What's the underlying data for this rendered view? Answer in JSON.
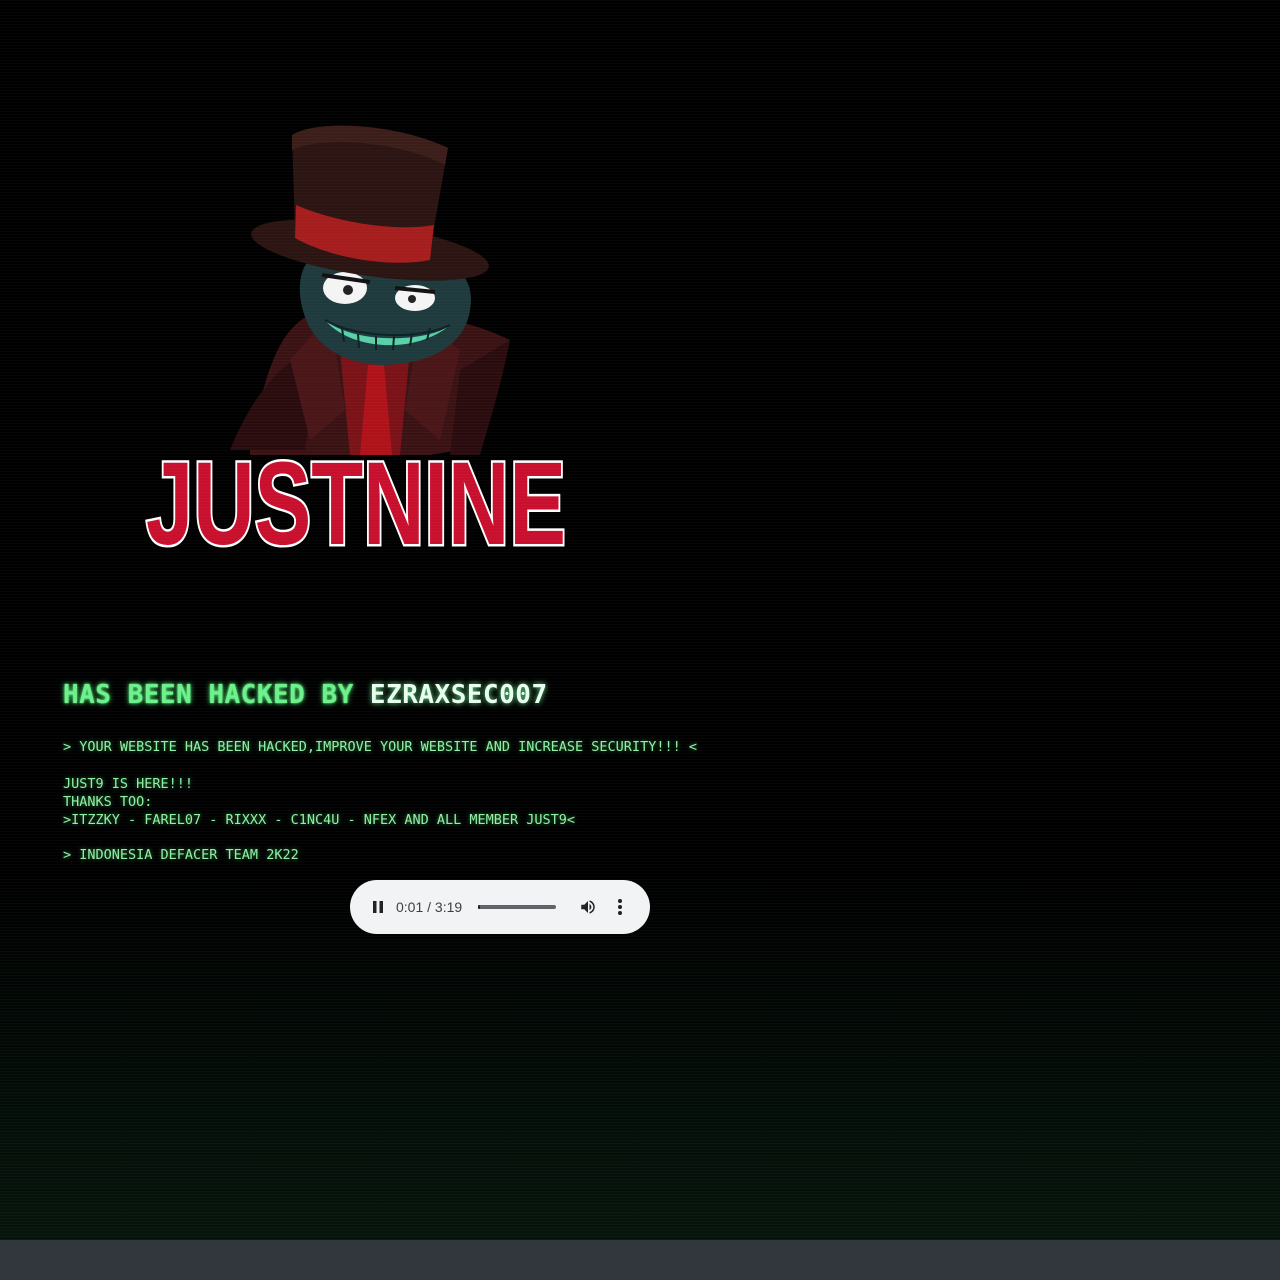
{
  "logo": {
    "text": "JUSTNINE",
    "colors": {
      "fill": "#c8102e",
      "outline": "#ffffff",
      "shadow": "#000000"
    }
  },
  "hero": {
    "icon": "top-hat-villain-illustration",
    "colors": {
      "hat": "#2b1412",
      "hat_band": "#a51d1d",
      "face": "#1e3a3d",
      "teeth": "#58d1a8",
      "coat": "#3a1214",
      "tie": "#b0121a"
    }
  },
  "headline": {
    "prefix": "HAS BEEN HACKED BY ",
    "author": "EZRAXSEC007"
  },
  "messages": {
    "warning": "> YOUR WEBSITE HAS BEEN HACKED,IMPROVE YOUR WEBSITE AND INCREASE SECURITY!!! <",
    "crew": "JUST9 IS HERE!!!\nTHANKS TOO:\n>ITZZKY - FAREL07 - RIXXX - C1NC4U - NFEX AND ALL MEMBER JUST9<",
    "team": "> INDONESIA DEFACER TEAM 2K22"
  },
  "audio": {
    "time_display": "0:01 / 3:19",
    "progress_fraction": 0.005,
    "state": "playing",
    "icons": {
      "play_pause": "pause-icon",
      "volume": "volume-icon",
      "menu": "more-vert-icon"
    }
  },
  "theme": {
    "background": "#000000",
    "text_green": "#8ff0a4",
    "headline_green": "#6ef08c",
    "bottom_bar": "#32363d"
  }
}
